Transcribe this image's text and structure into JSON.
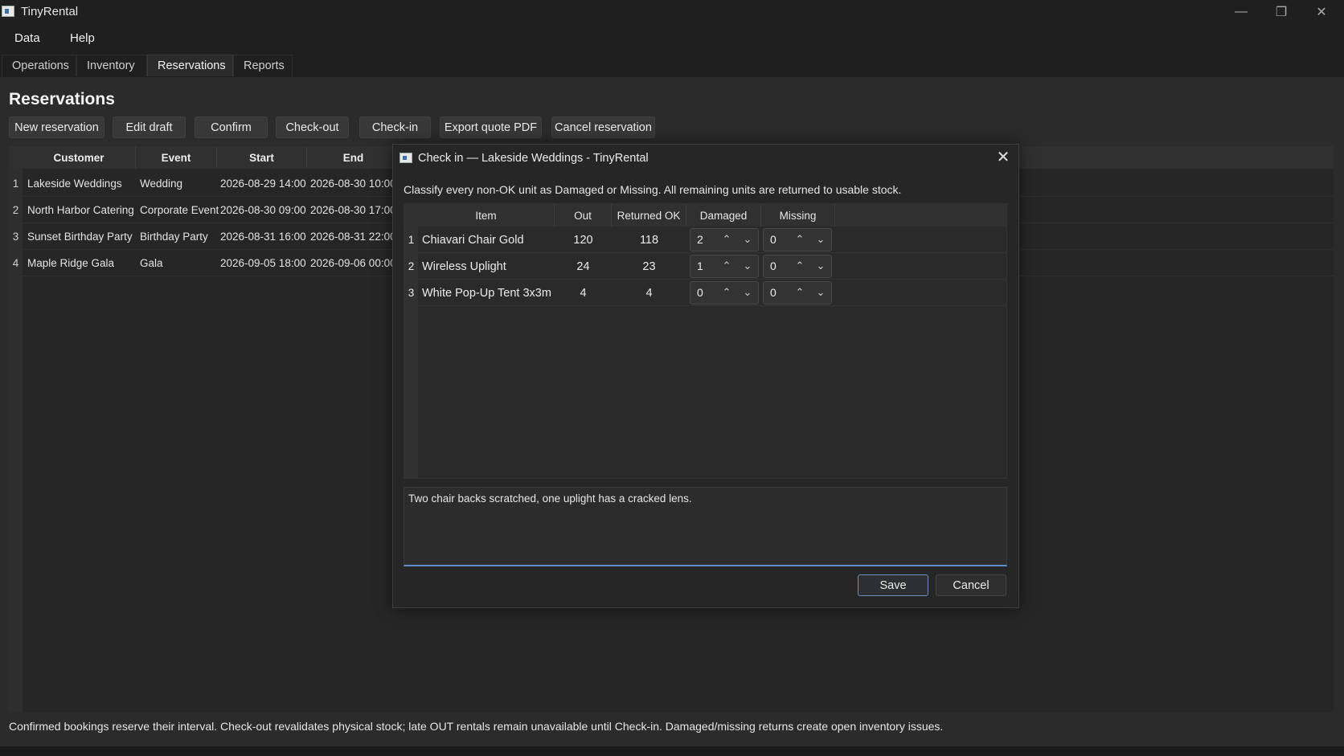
{
  "window": {
    "title": "TinyRental"
  },
  "menu": [
    "Data",
    "Help"
  ],
  "tabs": [
    "Operations",
    "Inventory",
    "Reservations",
    "Reports"
  ],
  "page": {
    "title": "Reservations"
  },
  "toolbar": [
    "New reservation",
    "Edit draft",
    "Confirm",
    "Check-out",
    "Check-in",
    "Export quote PDF",
    "Cancel reservation"
  ],
  "reservations": {
    "columns": [
      "Customer",
      "Event",
      "Start",
      "End"
    ],
    "rows": [
      {
        "n": "1",
        "customer": "Lakeside Weddings",
        "event": "Wedding",
        "start": "2026-08-29 14:00",
        "end": "2026-08-30 10:00"
      },
      {
        "n": "2",
        "customer": "North Harbor Catering",
        "event": "Corporate Event",
        "start": "2026-08-30 09:00",
        "end": "2026-08-30 17:00"
      },
      {
        "n": "3",
        "customer": "Sunset Birthday Party",
        "event": "Birthday Party",
        "start": "2026-08-31 16:00",
        "end": "2026-08-31 22:00"
      },
      {
        "n": "4",
        "customer": "Maple Ridge Gala",
        "event": "Gala",
        "start": "2026-09-05 18:00",
        "end": "2026-09-06 00:00"
      }
    ]
  },
  "status": "Confirmed bookings reserve their interval. Check-out revalidates physical stock; late OUT rentals remain unavailable until Check-in. Damaged/missing returns create open inventory issues.",
  "dialog": {
    "title": "Check in — Lakeside Weddings - TinyRental",
    "instruction": "Classify every non-OK unit as Damaged or Missing. All remaining units are returned to usable stock.",
    "columns": [
      "Item",
      "Out",
      "Returned OK",
      "Damaged",
      "Missing"
    ],
    "rows": [
      {
        "n": "1",
        "item": "Chiavari Chair Gold",
        "out": "120",
        "returned_ok": "118",
        "damaged": "2",
        "missing": "0"
      },
      {
        "n": "2",
        "item": "Wireless Uplight",
        "out": "24",
        "returned_ok": "23",
        "damaged": "1",
        "missing": "0"
      },
      {
        "n": "3",
        "item": "White Pop-Up Tent 3x3m",
        "out": "4",
        "returned_ok": "4",
        "damaged": "0",
        "missing": "0"
      }
    ],
    "notes": "Two chair backs scratched, one uplight has a cracked lens.",
    "save_label": "Save",
    "cancel_label": "Cancel"
  }
}
